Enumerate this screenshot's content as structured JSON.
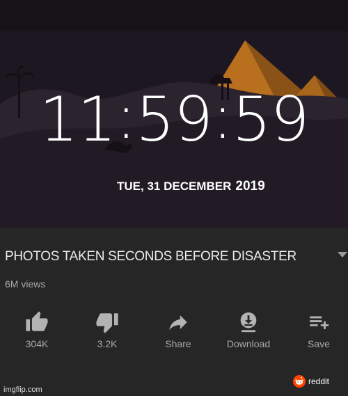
{
  "clock": {
    "hours": "11",
    "minutes": "59",
    "seconds": "59",
    "separator": ":",
    "date": "TUE, 31 DECEMBER",
    "year": "2019"
  },
  "video": {
    "title": "PHOTOS TAKEN SECONDS BEFORE DISASTER",
    "views": "6M views"
  },
  "actions": {
    "like": {
      "label": "304K",
      "icon": "thumb-up-icon"
    },
    "dislike": {
      "label": "3.2K",
      "icon": "thumb-down-icon"
    },
    "share": {
      "label": "Share",
      "icon": "share-arrow-icon"
    },
    "download": {
      "label": "Download",
      "icon": "download-icon"
    },
    "save": {
      "label": "Save",
      "icon": "playlist-add-icon"
    }
  },
  "watermark": "imgflip.com",
  "reddit_badge": "reddit",
  "colors": {
    "clock_bg": "#1c1720",
    "pyramid": "#b8701e",
    "info_bg": "#262626",
    "icon": "#b3b3b3"
  }
}
